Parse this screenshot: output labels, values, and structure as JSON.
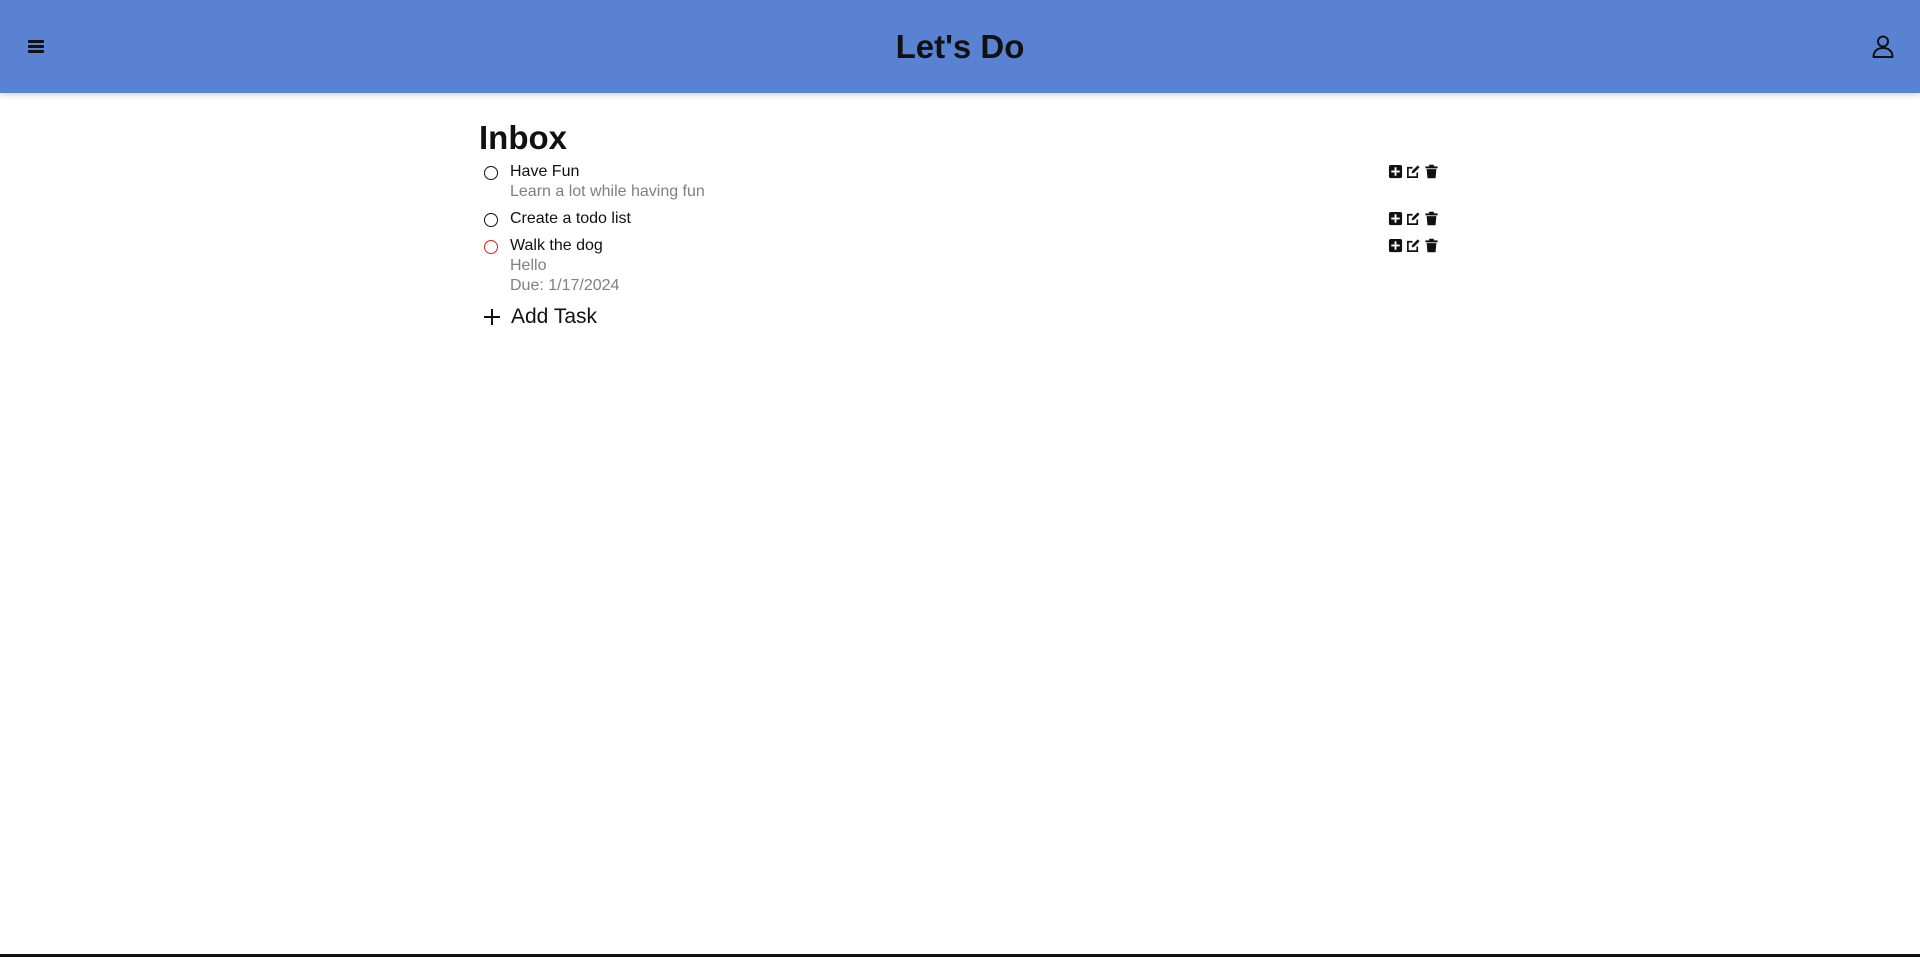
{
  "header": {
    "title": "Let's Do",
    "background_color": "#5a82d3",
    "menu_icon": "hamburger-menu-icon",
    "user_icon": "user-profile-icon"
  },
  "main": {
    "list_title": "Inbox",
    "tasks": [
      {
        "name": "Have Fun",
        "description": "Learn a lot while having fun",
        "due": "",
        "circle_color": "#111111"
      },
      {
        "name": "Create a todo list",
        "description": "",
        "due": "",
        "circle_color": "#111111"
      },
      {
        "name": "Walk the dog",
        "description": "Hello",
        "due": "Due: 1/17/2024",
        "circle_color": "#e02020"
      }
    ],
    "task_actions": [
      "add-subtask-icon",
      "edit-icon",
      "delete-icon"
    ],
    "add_task_label": "Add Task"
  }
}
